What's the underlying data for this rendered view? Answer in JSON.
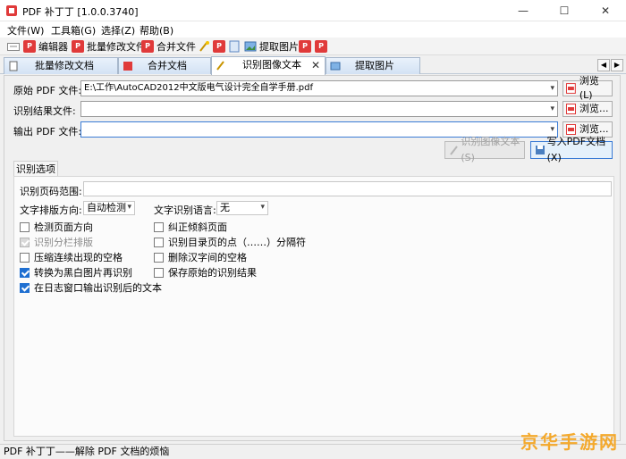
{
  "window": {
    "title": "PDF 补丁丁 [1.0.0.3740]",
    "minimize": "—",
    "maximize": "☐",
    "close": "✕"
  },
  "menu": [
    "文件(W)",
    "工具箱(G)",
    "选择(Z)",
    "帮助(B)"
  ],
  "toolbar": {
    "editor": "编辑器",
    "batch_modify": "批量修改文件",
    "merge": "合并文件",
    "extract_images": "提取图片"
  },
  "tabs": [
    {
      "label": "批量修改文档",
      "icon": "doc-icon"
    },
    {
      "label": "合并文档",
      "icon": "merge-icon"
    },
    {
      "label": "识别图像文本",
      "icon": "ocr-icon",
      "active": true
    },
    {
      "label": "提取图片",
      "icon": "image-icon"
    }
  ],
  "tab_scroll": {
    "left": "◀",
    "right": "▶"
  },
  "form": {
    "source_label": "原始 PDF 文件:",
    "source_value": "E:\\工作\\AutoCAD2012中文版电气设计完全自学手册.pdf",
    "result_label": "识别结果文件:",
    "result_value": "",
    "output_label": "输出 PDF 文件:",
    "output_value": "",
    "browse_primary": "浏览(L)",
    "browse": "浏览...",
    "recognize_button": "识别图像文本(S)",
    "write_button": "写入PDF文档(X)"
  },
  "options": {
    "section_title": "识别选项",
    "page_range_label": "识别页码范围:",
    "page_range_value": "",
    "direction_label": "文字排版方向:",
    "direction_value": "自动检测",
    "language_label": "文字识别语言:",
    "language_value": "无",
    "checkboxes_left": [
      {
        "label": "检测页面方向",
        "checked": false,
        "disabled": false
      },
      {
        "label": "识别分栏排版",
        "checked": true,
        "disabled": true
      },
      {
        "label": "压缩连续出现的空格",
        "checked": false,
        "disabled": false
      },
      {
        "label": "转换为黑白图片再识别",
        "checked": true,
        "disabled": false
      },
      {
        "label": "在日志窗口输出识别后的文本",
        "checked": true,
        "disabled": false
      }
    ],
    "checkboxes_right": [
      {
        "label": "纠正倾斜页面",
        "checked": false,
        "disabled": false
      },
      {
        "label": "识别目录页的点（……）分隔符",
        "checked": false,
        "disabled": false
      },
      {
        "label": "删除汉字间的空格",
        "checked": false,
        "disabled": false
      },
      {
        "label": "保存原始的识别结果",
        "checked": false,
        "disabled": false
      }
    ]
  },
  "status": "PDF 补丁丁——解除 PDF 文档的烦恼",
  "watermark": "京华手游网",
  "colors": {
    "accent": "#3a7bd5",
    "pdf_red": "#e03a3a",
    "watermark": "#f5a623"
  }
}
